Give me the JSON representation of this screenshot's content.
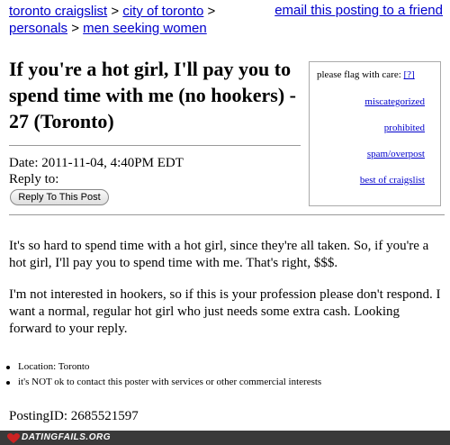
{
  "breadcrumb": {
    "site": "toronto craigslist",
    "sep1": ">",
    "city": "city of toronto",
    "sep2": ">",
    "section": "personals",
    "sep3": ">",
    "category": "men seeking women"
  },
  "email_link": "email this posting to a friend",
  "title": "If you're a hot girl, I'll pay you to spend time with me (no hookers) - 27 (Toronto)",
  "meta": {
    "date": "Date: 2011-11-04, 4:40PM EDT",
    "reply_to": "Reply to:",
    "reply_button": "Reply To This Post"
  },
  "flag_box": {
    "header": "please flag with care:",
    "help": "[?]",
    "items": [
      "miscategorized",
      "prohibited",
      "spam/overpost",
      "best of craigslist"
    ]
  },
  "body": {
    "p1": "It's so hard to spend time with a hot girl, since they're all taken. So, if you're a hot girl, I'll pay you to spend time with me. That's right, $$$.",
    "p2": "I'm not interested in hookers, so if this is your profession please don't respond. I want a normal, regular hot girl who just needs some extra cash. Looking forward to your reply."
  },
  "bullets": [
    "Location: Toronto",
    "it's NOT ok to contact this poster with services or other commercial interests"
  ],
  "posting_id": "PostingID: 2685521597",
  "footer": {
    "logo": "DATINGFAILS.ORG",
    "colors": {
      "bar": "#3a3a3a",
      "heart": "#cc2222"
    }
  },
  "colors": {
    "link": "#0000cc",
    "rule": "#999999"
  }
}
